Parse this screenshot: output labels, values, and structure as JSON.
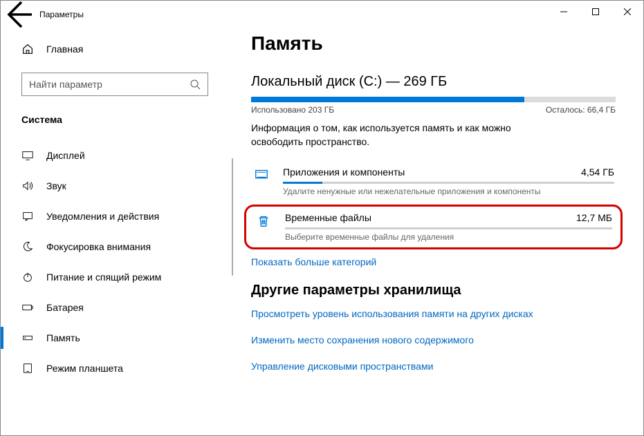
{
  "window": {
    "title": "Параметры"
  },
  "sidebar": {
    "home": "Главная",
    "searchPlaceholder": "Найти параметр",
    "category": "Система",
    "items": [
      {
        "label": "Дисплей"
      },
      {
        "label": "Звук"
      },
      {
        "label": "Уведомления и действия"
      },
      {
        "label": "Фокусировка внимания"
      },
      {
        "label": "Питание и спящий режим"
      },
      {
        "label": "Батарея"
      },
      {
        "label": "Память"
      },
      {
        "label": "Режим планшета"
      }
    ]
  },
  "content": {
    "pageTitle": "Память",
    "diskTitle": "Локальный диск (C:) — 269 ГБ",
    "usagePercent": 75,
    "usedLabel": "Использовано 203 ГБ",
    "freeLabel": "Осталось: 66,4 ГБ",
    "description": "Информация о том, как используется память и как можно освободить пространство.",
    "entryApps": {
      "title": "Приложения и компоненты",
      "size": "4,54 ГБ",
      "sub": "Удалите ненужные или нежелательные приложения и компоненты",
      "percent": 12
    },
    "entryTemp": {
      "title": "Временные файлы",
      "size": "12,7 МБ",
      "sub": "Выберите временные файлы для удаления",
      "percent": 0
    },
    "moreCategories": "Показать больше категорий",
    "otherHeader": "Другие параметры хранилища",
    "links": [
      "Просмотреть уровень использования памяти на других дисках",
      "Изменить место сохранения нового содержимого",
      "Управление дисковыми пространствами"
    ]
  }
}
